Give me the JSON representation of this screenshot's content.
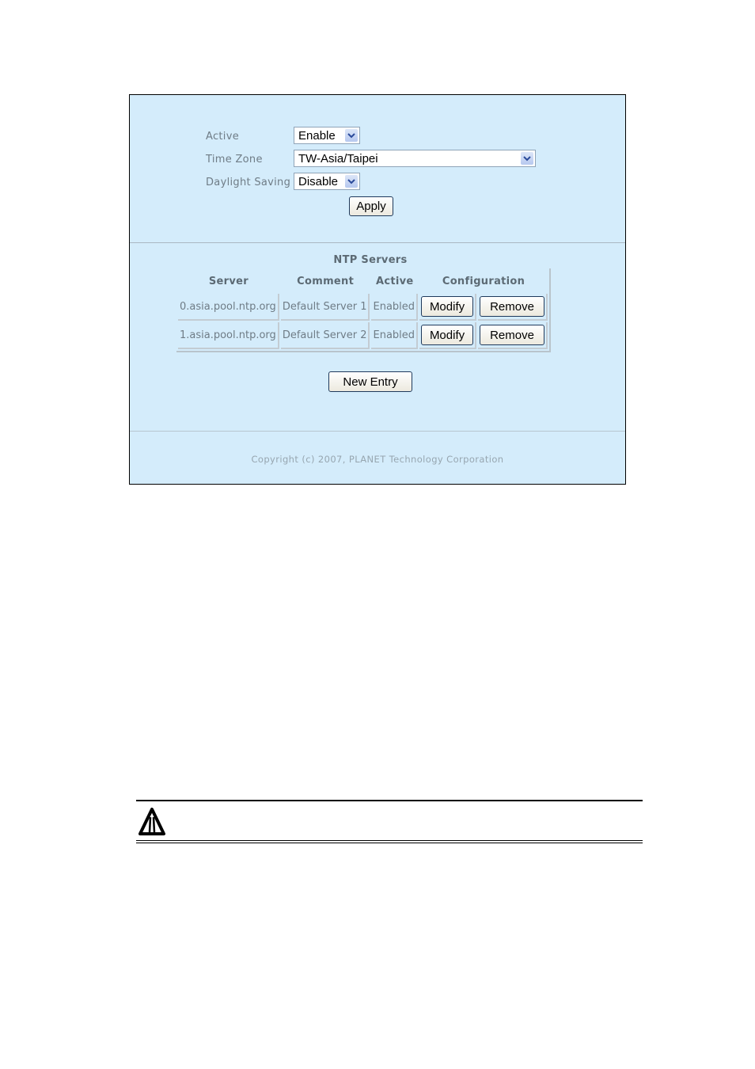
{
  "settings": {
    "active": {
      "label": "Active",
      "value": "Enable"
    },
    "time_zone": {
      "label": "Time Zone",
      "value": "TW-Asia/Taipei"
    },
    "daylight_saving": {
      "label": "Daylight Saving",
      "value": "Disable"
    },
    "apply_label": "Apply"
  },
  "ntp": {
    "title": "NTP Servers",
    "headers": [
      "Server",
      "Comment",
      "Active",
      "Configuration"
    ],
    "rows": [
      {
        "server": "0.asia.pool.ntp.org",
        "comment": "Default Server 1",
        "active": "Enabled",
        "modify": "Modify",
        "remove": "Remove"
      },
      {
        "server": "1.asia.pool.ntp.org",
        "comment": "Default Server 2",
        "active": "Enabled",
        "modify": "Modify",
        "remove": "Remove"
      }
    ],
    "new_entry_label": "New Entry"
  },
  "footer": {
    "copyright": "Copyright (c) 2007, PLANET Technology Corporation"
  },
  "note": {
    "icon": "warning-icon"
  }
}
